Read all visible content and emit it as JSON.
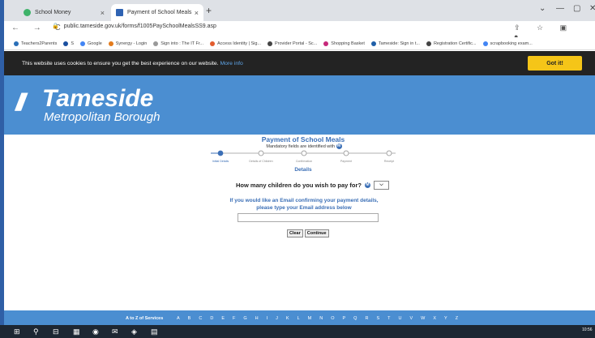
{
  "browser": {
    "tabs": [
      {
        "label": "School Money",
        "close": "×",
        "active": false
      },
      {
        "label": "Payment of School Meals",
        "close": "×",
        "active": true
      }
    ],
    "new_tab": "+",
    "window_controls": [
      "⌄",
      "—",
      "▢",
      "✕"
    ],
    "nav_glyphs": "← → C",
    "url": "public.tameside.gov.uk/forms/f1005PaySchoolMealsSS9.asp",
    "toolbar_icons": "⇪ ☆ ▣ ●",
    "bookmarks": [
      {
        "label": "Teachers2Parents",
        "color": "#2a6fb8"
      },
      {
        "label": "S",
        "color": "#1a4fa0"
      },
      {
        "label": "Google",
        "color": "#4285f4"
      },
      {
        "label": "Synergy - Login",
        "color": "#e37b1c"
      },
      {
        "label": "Sign into : The IT Fr...",
        "color": "#999999"
      },
      {
        "label": "Access Identity | Sig...",
        "color": "#e25c2e"
      },
      {
        "label": "Provider Portal - Sc...",
        "color": "#444444"
      },
      {
        "label": "Shopping Basket",
        "color": "#c6287a"
      },
      {
        "label": "Tameside: Sign in t...",
        "color": "#1f5fa8"
      },
      {
        "label": "Registration Certific...",
        "color": "#444444"
      },
      {
        "label": "scrapbooking exam...",
        "color": "#4285f4"
      }
    ]
  },
  "cookie_bar": {
    "text": "This website uses cookies to ensure you get the best experience on our website.",
    "more_info": "More info",
    "button": "Got it!"
  },
  "header": {
    "logo_mark": "///",
    "logo_name": "Tameside",
    "logo_sub": "Metropolitan Borough"
  },
  "form": {
    "title": "Payment of School Meals",
    "mandatory_note": "Mandatory fields are identified with",
    "mandatory_badge": "M",
    "steps": [
      "Initial Details",
      "Details of Children",
      "Confirmation",
      "Payment",
      "Receipt"
    ],
    "current_step_index": 0,
    "section_title": "Details",
    "question": "How many children do you wish to pay for?",
    "children_select_value": "",
    "email_intro_line1": "If you would like an Email confirming your payment details,",
    "email_intro_line2": "please type your Email address below",
    "email_value": "",
    "clear_label": "Clear",
    "continue_label": "Continue"
  },
  "footer": {
    "atoz_label": "A to Z of Services",
    "letters": [
      "A",
      "B",
      "C",
      "D",
      "E",
      "F",
      "G",
      "H",
      "I",
      "J",
      "K",
      "L",
      "M",
      "N",
      "O",
      "P",
      "Q",
      "R",
      "S",
      "T",
      "U",
      "V",
      "W",
      "X",
      "Y",
      "Z"
    ]
  },
  "taskbar": {
    "icons": [
      "⊞",
      "⚲",
      "⊟",
      "▦",
      "◉",
      "✉",
      "◈",
      "▤"
    ],
    "clock": "10:56"
  },
  "colors": {
    "brand_blue": "#4b8ed1",
    "link_blue": "#3b6fb6",
    "cookie_bg": "#232323",
    "got_it": "#f5c518"
  }
}
